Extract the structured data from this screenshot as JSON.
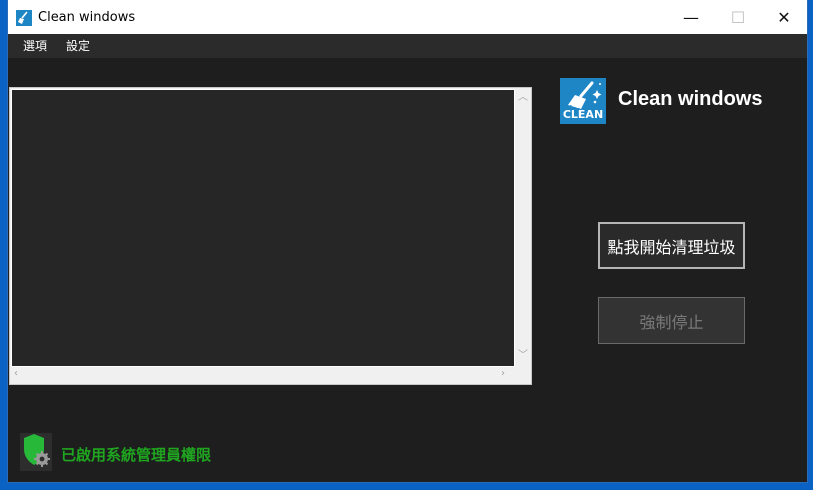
{
  "window": {
    "title": "Clean windows",
    "controls": {
      "minimize": "—",
      "maximize": "☐",
      "close": "✕"
    }
  },
  "menu": {
    "items": [
      "選項",
      "設定"
    ]
  },
  "log": {
    "content": ""
  },
  "brand": {
    "logo_text": "CLEAN",
    "name": "Clean windows",
    "logo_icon": "broom-icon"
  },
  "actions": {
    "start_label": "點我開始清理垃圾",
    "stop_label": "強制停止"
  },
  "status": {
    "text": "已啟用系統管理員權限",
    "icon": "admin-shield-icon"
  },
  "colors": {
    "accent": "#1f86c6",
    "status_green": "#1fa51f",
    "background": "#1e1e1e"
  }
}
